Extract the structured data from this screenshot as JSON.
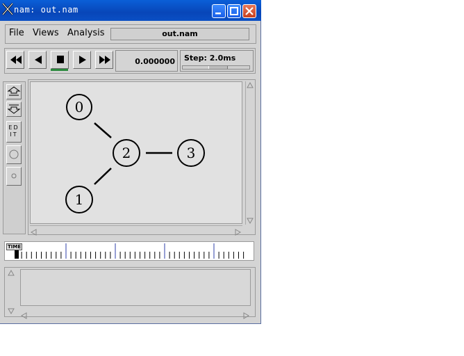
{
  "window": {
    "title": "nam: out.nam"
  },
  "menubar": {
    "items": [
      {
        "label": "File"
      },
      {
        "label": "Views"
      },
      {
        "label": "Analysis"
      }
    ],
    "filename": "out.nam"
  },
  "controls": {
    "buttons": [
      {
        "name": "rewind-icon"
      },
      {
        "name": "play-backward-icon"
      },
      {
        "name": "stop-icon"
      },
      {
        "name": "play-forward-icon"
      },
      {
        "name": "fast-forward-icon"
      }
    ],
    "time": "0.000000",
    "step_label": "Step: 2.0ms"
  },
  "tools": {
    "edit_label_1": "ED",
    "edit_label_2": "IT"
  },
  "topology": {
    "nodes": [
      {
        "id": "0"
      },
      {
        "id": "1"
      },
      {
        "id": "2"
      },
      {
        "id": "3"
      }
    ],
    "links": [
      [
        "0",
        "2"
      ],
      [
        "1",
        "2"
      ],
      [
        "2",
        "3"
      ]
    ]
  },
  "timeline": {
    "label": "TIME"
  },
  "colors": {
    "titlebar": "#0846b8",
    "stop_indicator": "#2b8a3e",
    "timeline_marker": "#2d3fa8"
  }
}
